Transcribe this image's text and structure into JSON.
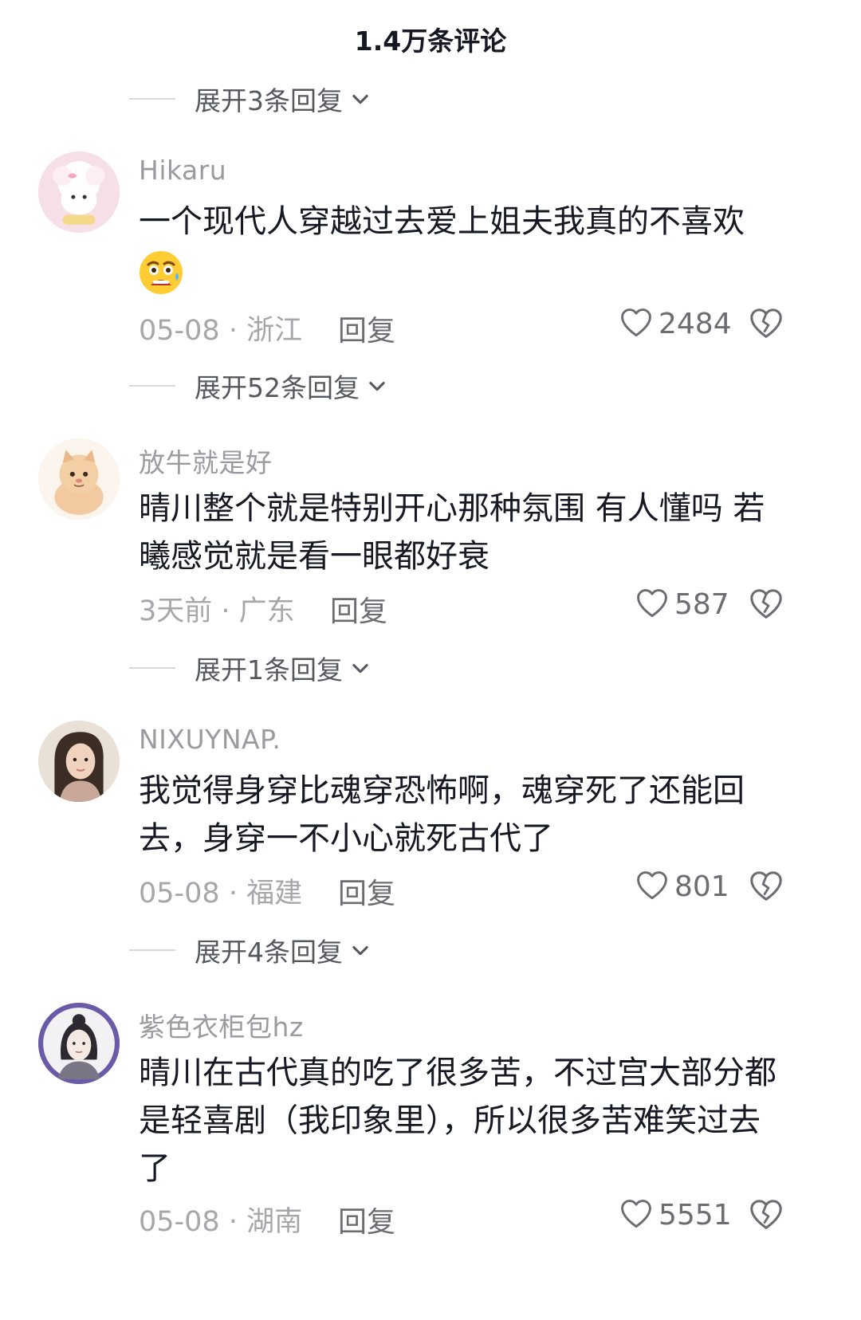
{
  "header": {
    "title": "1.4万条评论"
  },
  "expanders": [
    {
      "label": "展开3条回复"
    },
    {
      "label": "展开52条回复"
    },
    {
      "label": "展开1条回复"
    },
    {
      "label": "展开4条回复"
    }
  ],
  "comments": [
    {
      "username": "Hikaru",
      "text": "一个现代人穿越过去爱上姐夫我真的不喜欢",
      "emoji": "scared-face-emoji",
      "date_region": "05-08 · 浙江",
      "reply_label": "回复",
      "likes": "2484"
    },
    {
      "username": "放牛就是好",
      "text_lines": [
        "晴川整个就是特别开心那种氛围 有人懂吗 若",
        "曦感觉就是看一眼都好衰"
      ],
      "date_region": "3天前 · 广东",
      "reply_label": "回复",
      "likes": "587"
    },
    {
      "username": "NIXUYNAP.",
      "text_lines": [
        "我觉得身穿比魂穿恐怖啊，魂穿死了还能回",
        "去，身穿一不小心就死古代了"
      ],
      "date_region": "05-08 · 福建",
      "reply_label": "回复",
      "likes": "801"
    },
    {
      "username": "紫色衣柜包hz",
      "text_lines": [
        "晴川在古代真的吃了很多苦，不过宫大部分都",
        "是轻喜剧（我印象里），所以很多苦难笑过去",
        "了"
      ],
      "date_region": "05-08 · 湖南",
      "reply_label": "回复",
      "likes": "5551"
    }
  ],
  "colors": {
    "text_primary": "#161823",
    "text_secondary": "#9a9ba0",
    "icon_gray": "#6b6d73"
  }
}
